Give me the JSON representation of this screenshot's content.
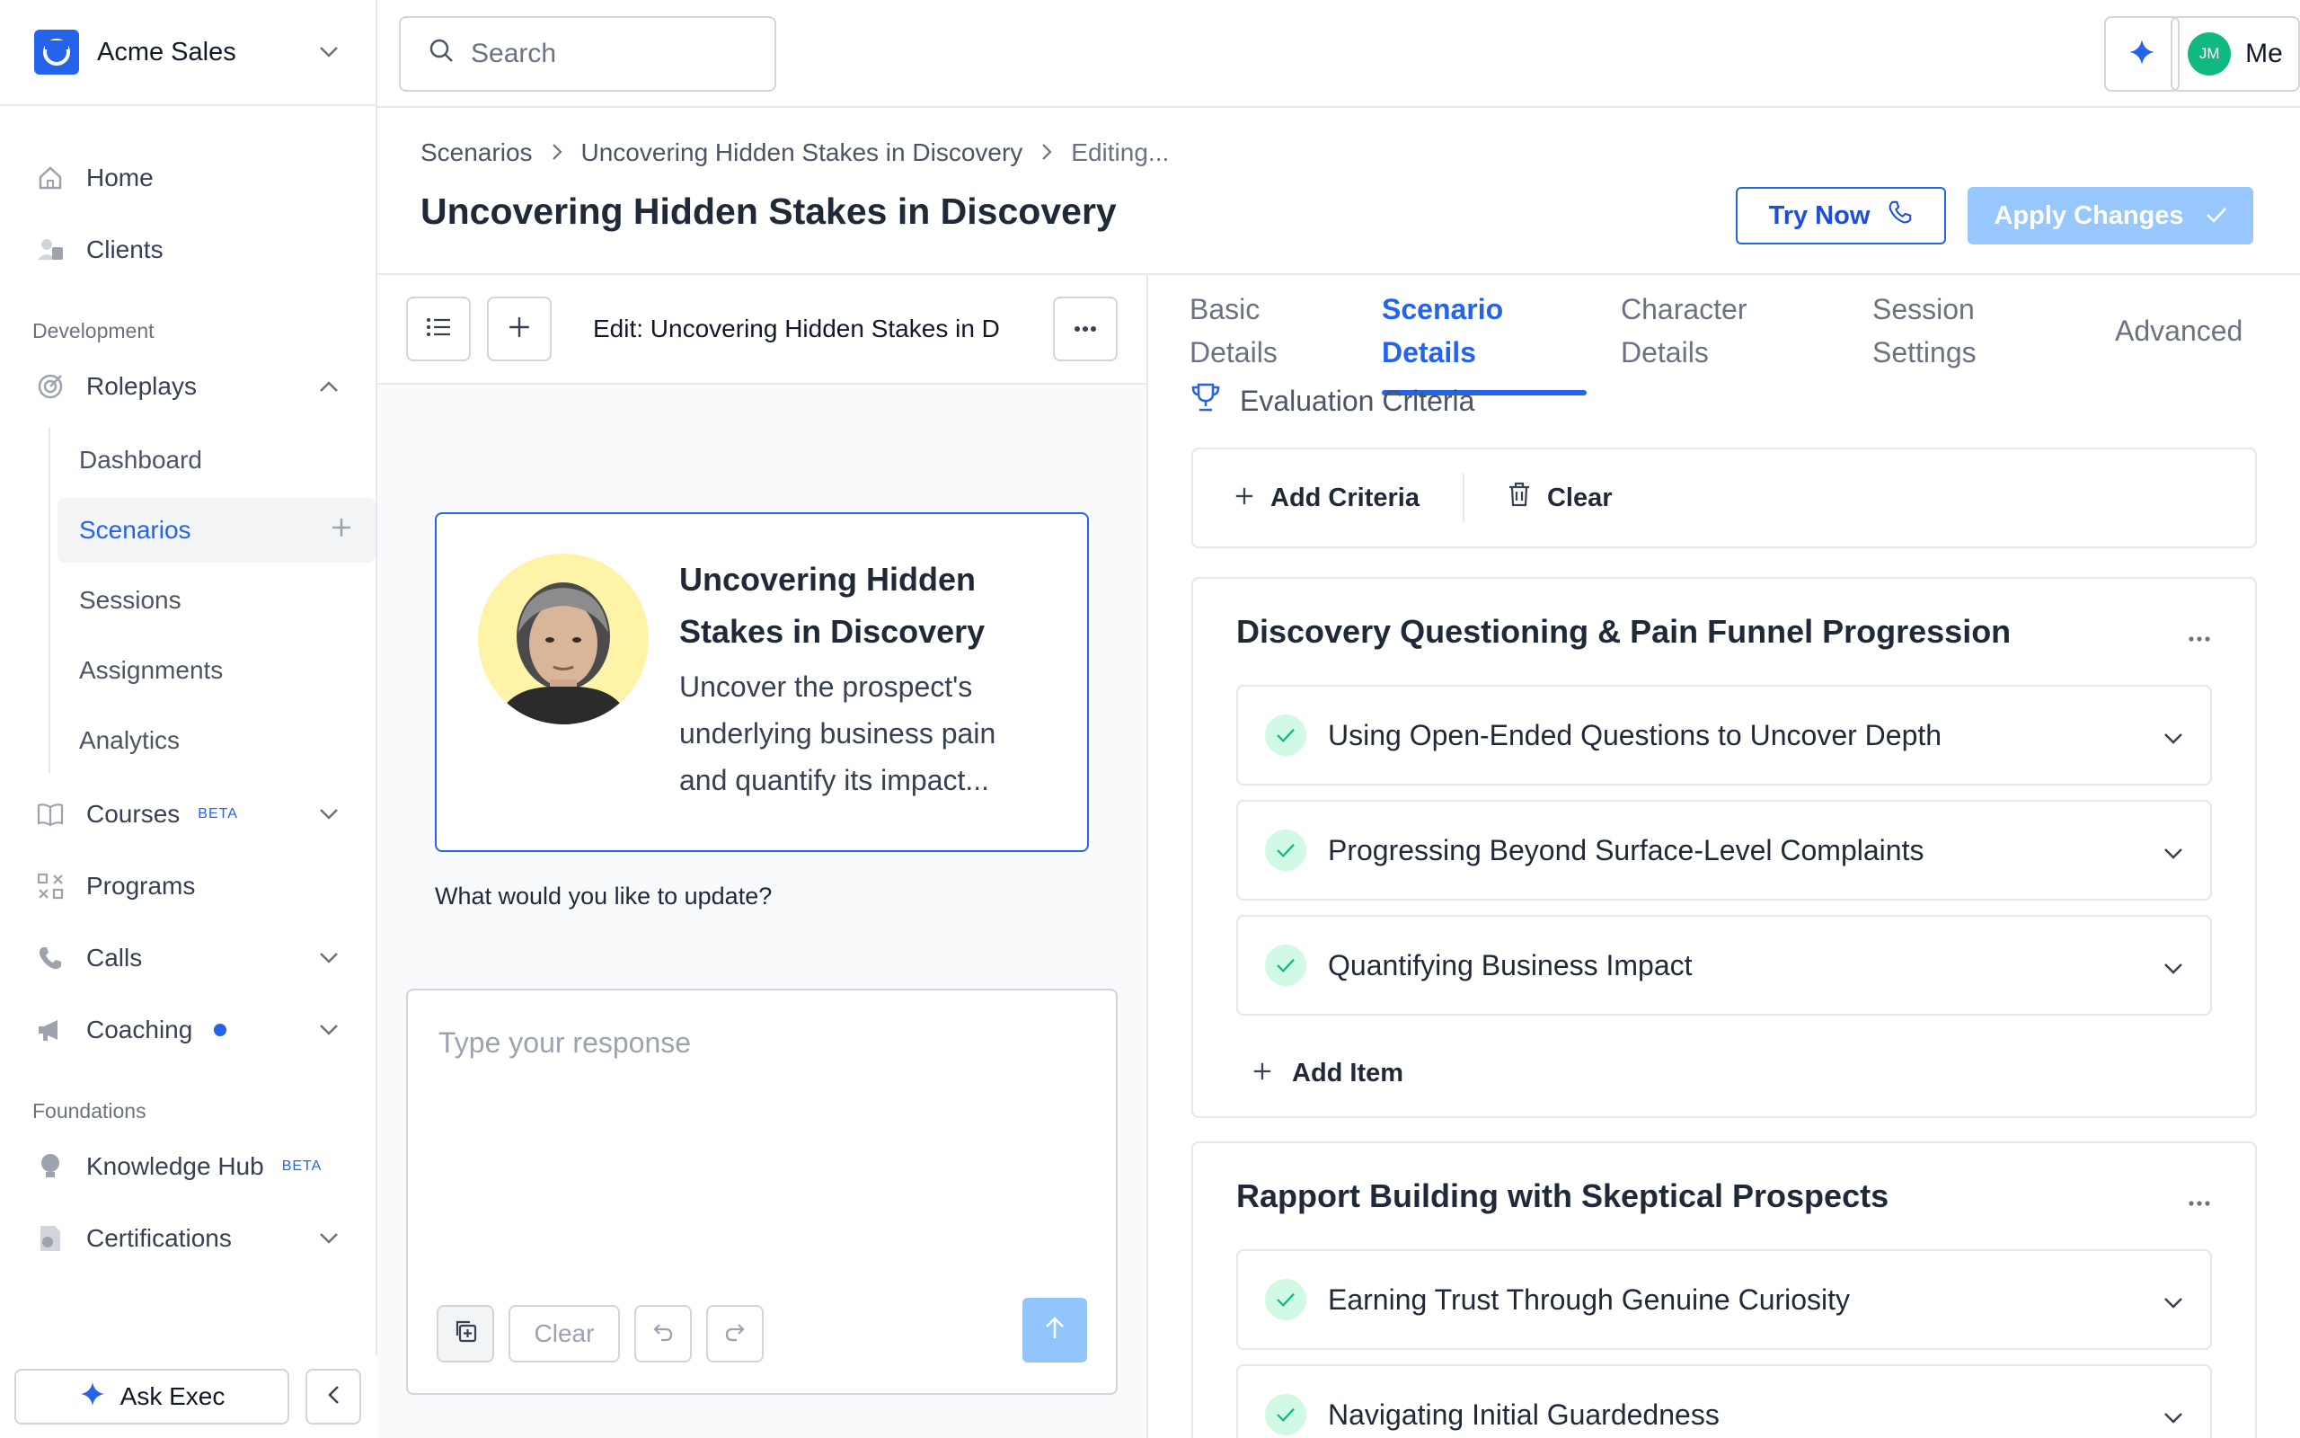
{
  "org": {
    "name": "Acme Sales"
  },
  "search": {
    "placeholder": "Search"
  },
  "user": {
    "initials": "JM",
    "label": "Me"
  },
  "sidebar": {
    "primary": [
      {
        "label": "Home",
        "icon": "home-icon"
      },
      {
        "label": "Clients",
        "icon": "users-icon"
      }
    ],
    "development_heading": "Development",
    "roleplays": {
      "label": "Roleplays",
      "icon": "target-icon"
    },
    "roleplay_items": [
      "Dashboard",
      "Scenarios",
      "Sessions",
      "Assignments",
      "Analytics"
    ],
    "courses": {
      "label": "Courses",
      "badge": "BETA"
    },
    "programs": {
      "label": "Programs"
    },
    "calls": {
      "label": "Calls"
    },
    "coaching": {
      "label": "Coaching"
    },
    "foundations_heading": "Foundations",
    "knowledge_hub": {
      "label": "Knowledge Hub",
      "badge": "BETA"
    },
    "certifications": {
      "label": "Certifications"
    },
    "ask_exec": "Ask Exec"
  },
  "header": {
    "breadcrumbs": [
      "Scenarios",
      "Uncovering Hidden Stakes in Discovery",
      "Editing..."
    ],
    "title": "Uncovering Hidden Stakes in Discovery",
    "try_now": "Try Now",
    "apply_changes": "Apply Changes"
  },
  "chat": {
    "title": "Edit: Uncovering Hidden Stakes in D",
    "card_title": "Uncovering Hidden Stakes in Discovery",
    "card_desc": "Uncover the prospect's underlying business pain and quantify its impact...",
    "question": "What would you like to update?",
    "placeholder": "Type your response",
    "clear": "Clear"
  },
  "editor": {
    "tabs": [
      {
        "line1": "Basic",
        "line2": "Details"
      },
      {
        "line1": "Scenario",
        "line2": "Details"
      },
      {
        "line1": "Character",
        "line2": "Details"
      },
      {
        "line1": "Session",
        "line2": "Settings"
      },
      {
        "line1": "Advanced",
        "line2": ""
      }
    ],
    "section_title": "Evaluation Criteria",
    "add_criteria": "Add Criteria",
    "clear": "Clear",
    "groups": [
      {
        "title": "Discovery Questioning & Pain Funnel Progression",
        "items": [
          "Using Open-Ended Questions to Uncover Depth",
          "Progressing Beyond Surface-Level Complaints",
          "Quantifying Business Impact"
        ],
        "add_item": "Add Item"
      },
      {
        "title": "Rapport Building with Skeptical Prospects",
        "items": [
          "Earning Trust Through Genuine Curiosity",
          "Navigating Initial Guardedness"
        ]
      }
    ]
  },
  "colors": {
    "accent": "#2563eb",
    "check_bg": "#d1fae5",
    "check": "#10b981",
    "apply_disabled": "#93c5fd"
  }
}
